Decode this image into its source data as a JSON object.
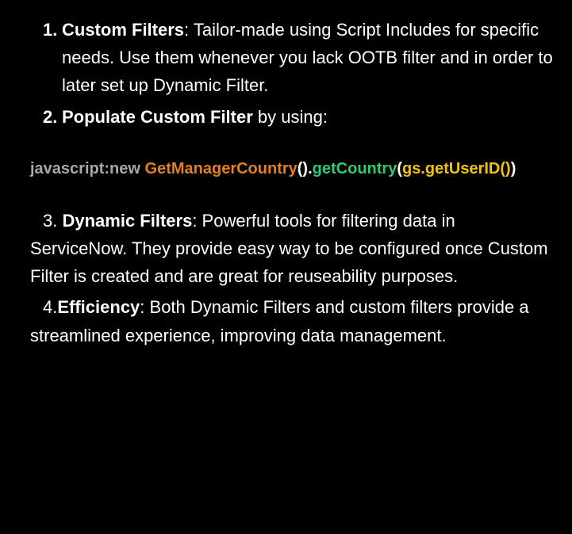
{
  "list": {
    "item1": {
      "number": "1.",
      "title": "Custom Filters",
      "text": ": Tailor-made using Script Includes for specific needs. Use them whenever you lack OOTB filter and in order to later set up Dynamic Filter."
    },
    "item2": {
      "number": "2.",
      "title": "Populate Custom Filter",
      "text": " by using:"
    },
    "item3": {
      "number": "3. ",
      "title": "Dynamic Filters",
      "text": ": Powerful tools for filtering data in ServiceNow. They provide easy way to be configured once Custom Filter is created and are great for reuseability purposes."
    },
    "item4": {
      "number": "4.",
      "title": "Efficiency",
      "text": ": Both Dynamic Filters and custom filters provide a streamlined experience, improving data management."
    }
  },
  "code": {
    "part1": "javascript:new ",
    "part2": "GetManagerCountry",
    "part3": "().",
    "part4": "getCountry",
    "part5": "(",
    "part6": "gs.getUserID()",
    "part7": ")"
  }
}
